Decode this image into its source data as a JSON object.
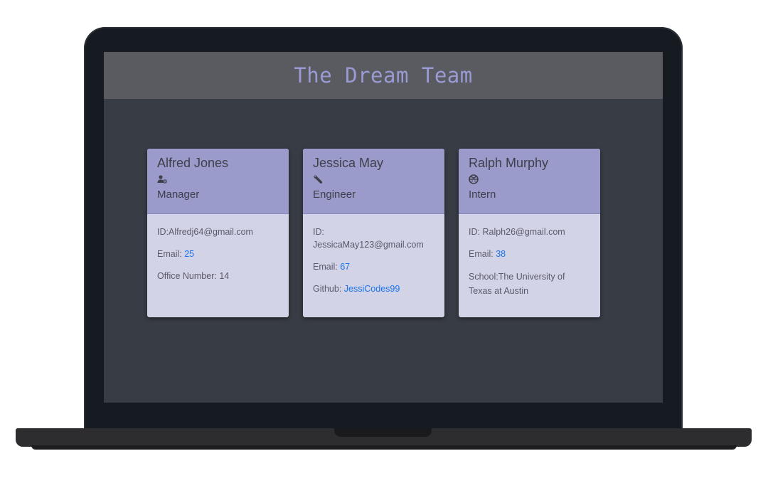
{
  "header": {
    "title": "The Dream Team"
  },
  "team": [
    {
      "name": "Alfred Jones",
      "icon": "manager-icon",
      "role": "Manager",
      "id_label": "ID:",
      "id_value": "Alfredj64@gmail.com",
      "email_label": "Email:",
      "email_value": "25",
      "extra_label": "Office Number:",
      "extra_value": "14"
    },
    {
      "name": "Jessica May",
      "icon": "wrench-icon",
      "role": "Engineer",
      "id_label": "ID:",
      "id_value": "JessicaMay123@gmail.com",
      "email_label": "Email:",
      "email_value": "67",
      "extra_label": "Github:",
      "extra_value": "JessiCodes99"
    },
    {
      "name": "Ralph Murphy",
      "icon": "graduate-icon",
      "role": "Intern",
      "id_label": "ID:",
      "id_value": "Ralph26@gmail.com",
      "email_label": "Email:",
      "email_value": "38",
      "extra_label": "School:",
      "extra_value": "The University of Texas at Austin"
    }
  ],
  "colors": {
    "screen_bg": "#383c44",
    "header_bg": "#5a5b60",
    "title": "#9a9ad4",
    "card_head": "#9a9acb",
    "card_body": "#d3d3e8",
    "link": "#1a73e8"
  }
}
